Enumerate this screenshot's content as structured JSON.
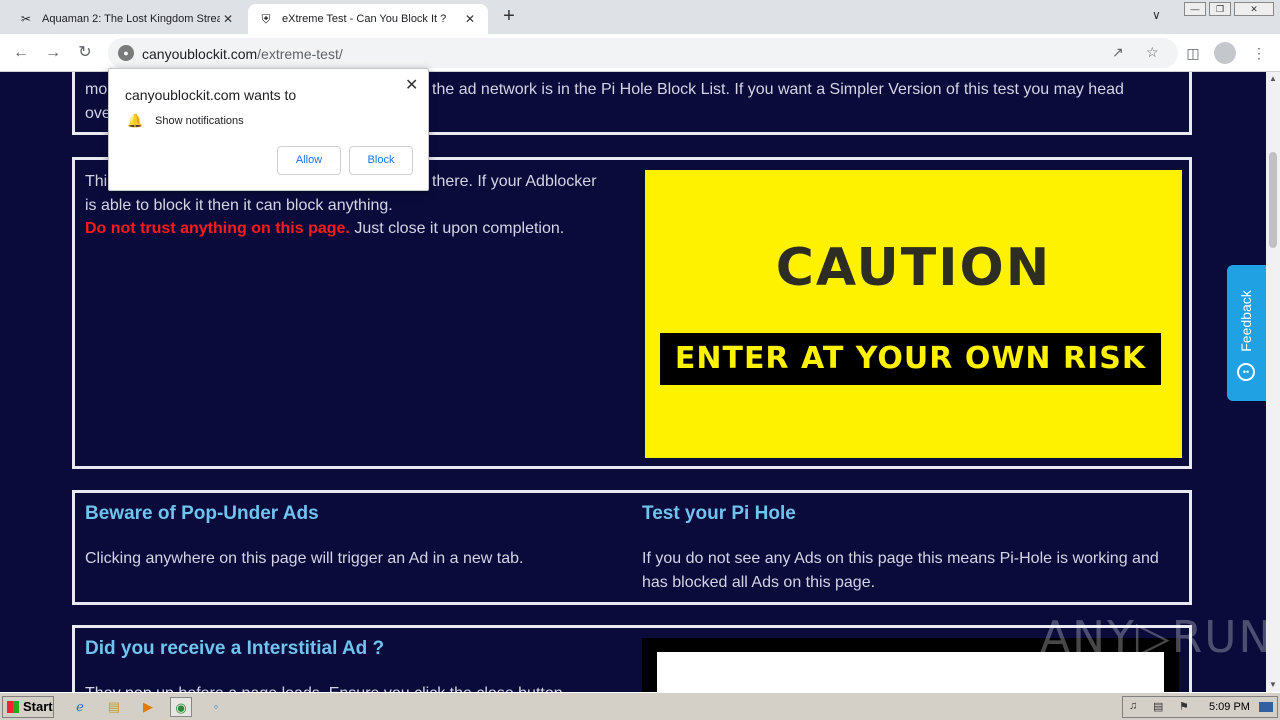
{
  "browser": {
    "tabs": [
      {
        "title": "Aquaman 2: The Lost Kingdom Strea",
        "active": false
      },
      {
        "title": "eXtreme Test - Can You Block It ?",
        "active": true
      }
    ],
    "new_tab": "+",
    "url_host": "canyoublockit.com",
    "url_path": "/extreme-test/"
  },
  "page": {
    "intro": {
      "text_left": "mo",
      "text_left2": "ove",
      "text_right": "the ad network is in the Pi Hole Block List. If you want a Simpler Version of this test you may head"
    },
    "caution_section": {
      "text_line1_start": "Thi",
      "text_line1_end": "there. If your Adblocker",
      "text_line2": "is able to block it then it can block anything.",
      "warning": "Do not trust anything on this page.",
      "after_warning": " Just close it upon completion.",
      "banner_caution": "CAUTION",
      "banner_risk": "ENTER AT YOUR OWN RISK"
    },
    "popunder": {
      "heading": "Beware of Pop-Under Ads",
      "text": "Clicking anywhere on this page will trigger an Ad in a new tab."
    },
    "pihole": {
      "heading": "Test your Pi Hole",
      "text": "If you do not see any Ads on this page this means Pi-Hole is working and has blocked all Ads on this page."
    },
    "interstitial": {
      "heading": "Did you receive a Interstitial Ad ?",
      "text": "They pop up before a page loads. Ensure you click the close button"
    }
  },
  "feedback": {
    "label": "Feedback"
  },
  "popup": {
    "title": "canyoublockit.com wants to",
    "permission": "Show notifications",
    "allow": "Allow",
    "block": "Block"
  },
  "watermark": "ANY▷RUN",
  "taskbar": {
    "start": "Start",
    "clock": "5:09 PM"
  },
  "colors": {
    "page_bg": "#0a0b3b",
    "heading": "#6fc3ee",
    "warning": "#ff1a1a",
    "banner": "#fff200",
    "feedback": "#1fa1e4"
  }
}
